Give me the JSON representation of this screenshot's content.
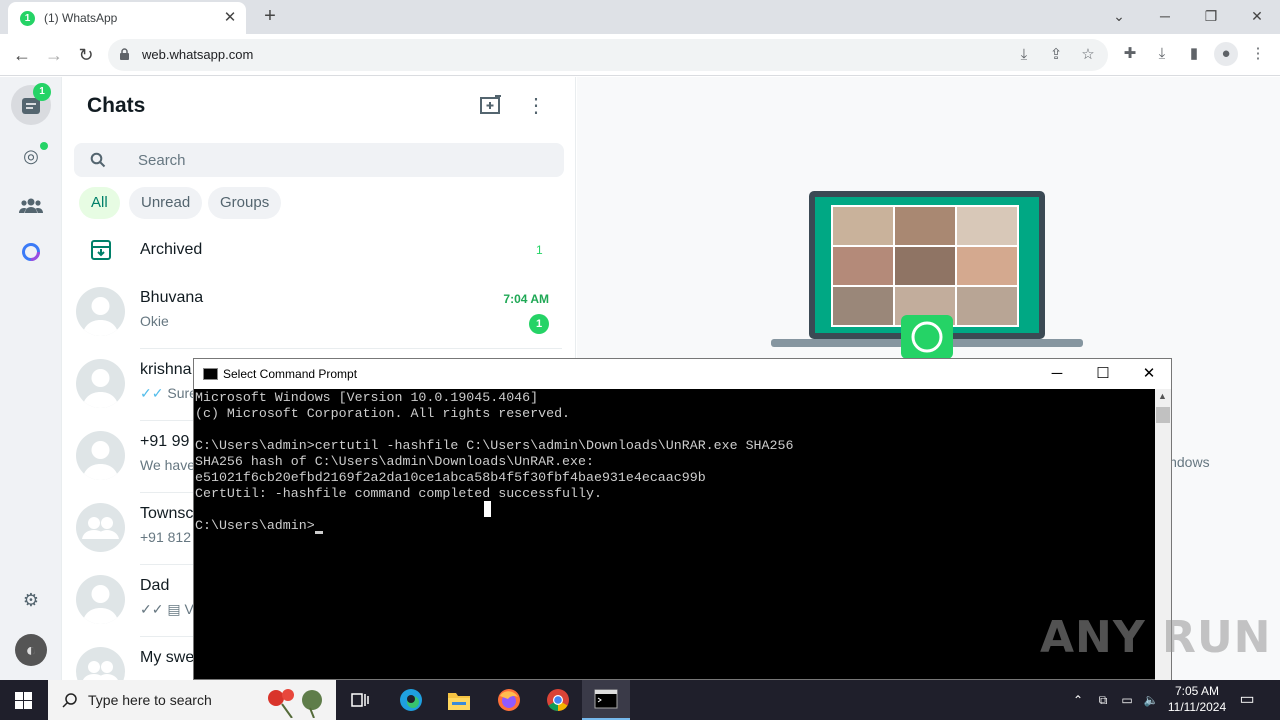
{
  "browser": {
    "tab_title": "(1) WhatsApp",
    "tab_badge": "1",
    "url": "web.whatsapp.com"
  },
  "whatsapp": {
    "rail": {
      "chats_badge": "1"
    },
    "header": {
      "title": "Chats"
    },
    "search": {
      "placeholder": "Search"
    },
    "filters": [
      "All",
      "Unread",
      "Groups"
    ],
    "archived": {
      "label": "Archived",
      "count": "1"
    },
    "chats": [
      {
        "name": "Bhuvana",
        "message": "Okie",
        "time": "7:04 AM",
        "unread": "1"
      },
      {
        "name": "krishna",
        "message": "Sure"
      },
      {
        "name": "+91 99",
        "message": "We have"
      },
      {
        "name": "Townsc",
        "message": "+91 812"
      },
      {
        "name": "Dad",
        "message": "Ve"
      },
      {
        "name": "My swe",
        "message": ""
      }
    ],
    "intro_fragment": "indows"
  },
  "cmd": {
    "title": "Select Command Prompt",
    "lines": [
      "Microsoft Windows [Version 10.0.19045.4046]",
      "(c) Microsoft Corporation. All rights reserved.",
      "",
      "C:\\Users\\admin>certutil -hashfile C:\\Users\\admin\\Downloads\\UnRAR.exe SHA256",
      "SHA256 hash of C:\\Users\\admin\\Downloads\\UnRAR.exe:",
      "e51021f6cb20efbd2169f2a2da10ce1abca58b4f5f30fbf4bae931e4ecaac99b",
      "CertUtil: -hashfile command completed successfully.",
      "",
      "C:\\Users\\admin>"
    ]
  },
  "watermark": "ANY RUN",
  "taskbar": {
    "search_placeholder": "Type here to search",
    "time": "7:05 AM",
    "date": "11/11/2024"
  }
}
